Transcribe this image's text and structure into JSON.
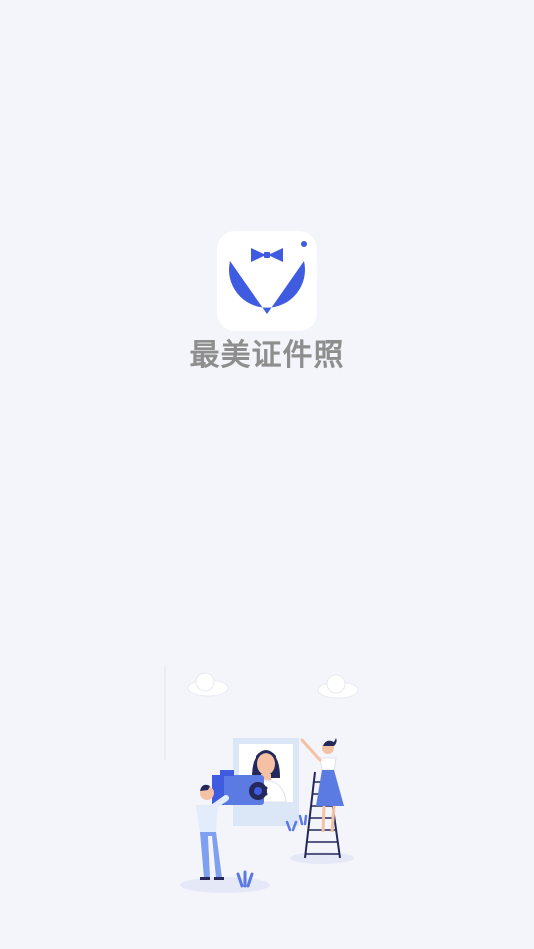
{
  "app": {
    "name": "最美证件照",
    "icon": "bow-tie-tuxedo-logo"
  },
  "illustration": {
    "icon": "photo-shoot-illustration"
  },
  "colors": {
    "background": "#f4f5fb",
    "brand_blue": "#3f5ce0",
    "app_name_gray": "#8e8e8e",
    "icon_tile": "#ffffff"
  }
}
